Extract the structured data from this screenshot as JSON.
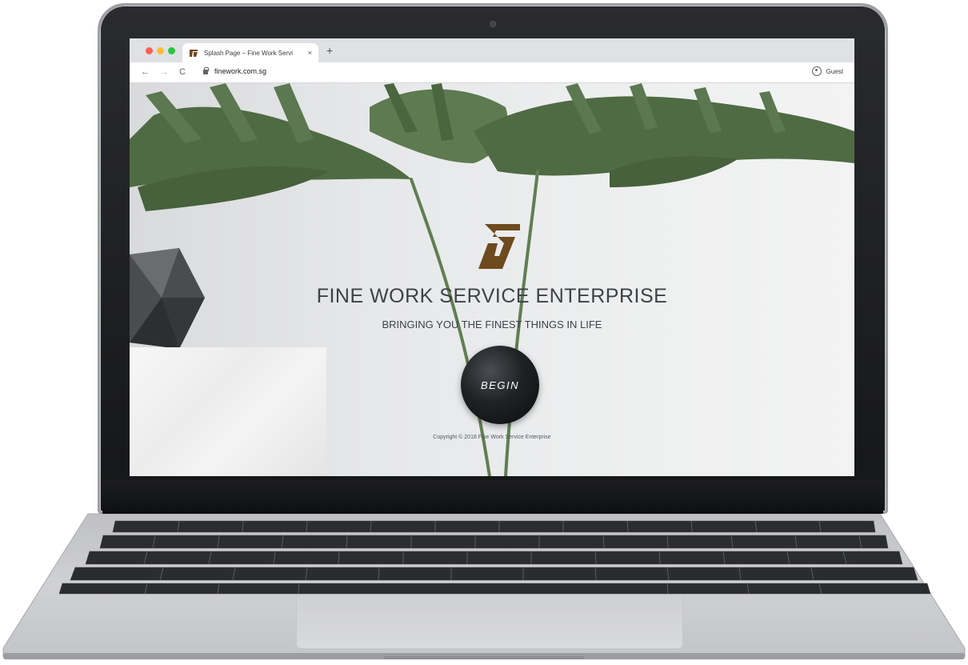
{
  "browser": {
    "tab_title": "Splash Page – Fine Work Servi",
    "tab_close": "×",
    "new_tab": "+",
    "nav_back": "←",
    "nav_forward": "→",
    "nav_reload": "C",
    "url": "finework.com.sg",
    "profile_label": "Guest"
  },
  "page": {
    "headline": "FINE WORK SERVICE ENTERPRISE",
    "subheadline": "BRINGING YOU THE FINEST THINGS IN LIFE",
    "begin_button": "BEGIN",
    "copyright": "Copyright © 2018 Fine Work Service Enterprise"
  },
  "colors": {
    "logo": "#6e4a1f",
    "headline": "#3e4248",
    "leaf": "#4f6b43",
    "button": "#1f2124"
  },
  "icons": [
    "window-close-dot",
    "window-minimize-dot",
    "window-maximize-dot",
    "favicon",
    "lock-icon",
    "guest-profile-icon",
    "monstera-leaf"
  ]
}
